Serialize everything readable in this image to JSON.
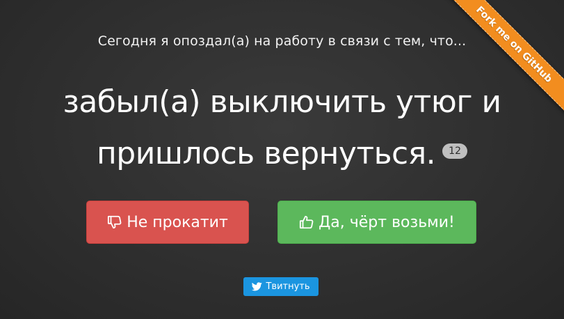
{
  "intro_text": "Сегодня я опоздал(а) на работу в связи с тем, что...",
  "excuse": {
    "text": "забыл(а) выключить утюг и пришлось вернуться.",
    "vote_count": "12"
  },
  "buttons": {
    "reject_label": "Не прокатит",
    "accept_label": "Да, чёрт возьми!",
    "tweet_label": "Твитнуть"
  },
  "ribbon": {
    "label": "Fork me on GitHub"
  },
  "icons": {
    "reject": "thumbs-down-icon",
    "accept": "thumbs-up-icon",
    "tweet": "twitter-bird-icon"
  },
  "colors": {
    "reject": "#d9534f",
    "accept": "#5cb85c",
    "tweet": "#1b95e0",
    "ribbon": "#f28d1f",
    "background": "#2e2e2e"
  }
}
